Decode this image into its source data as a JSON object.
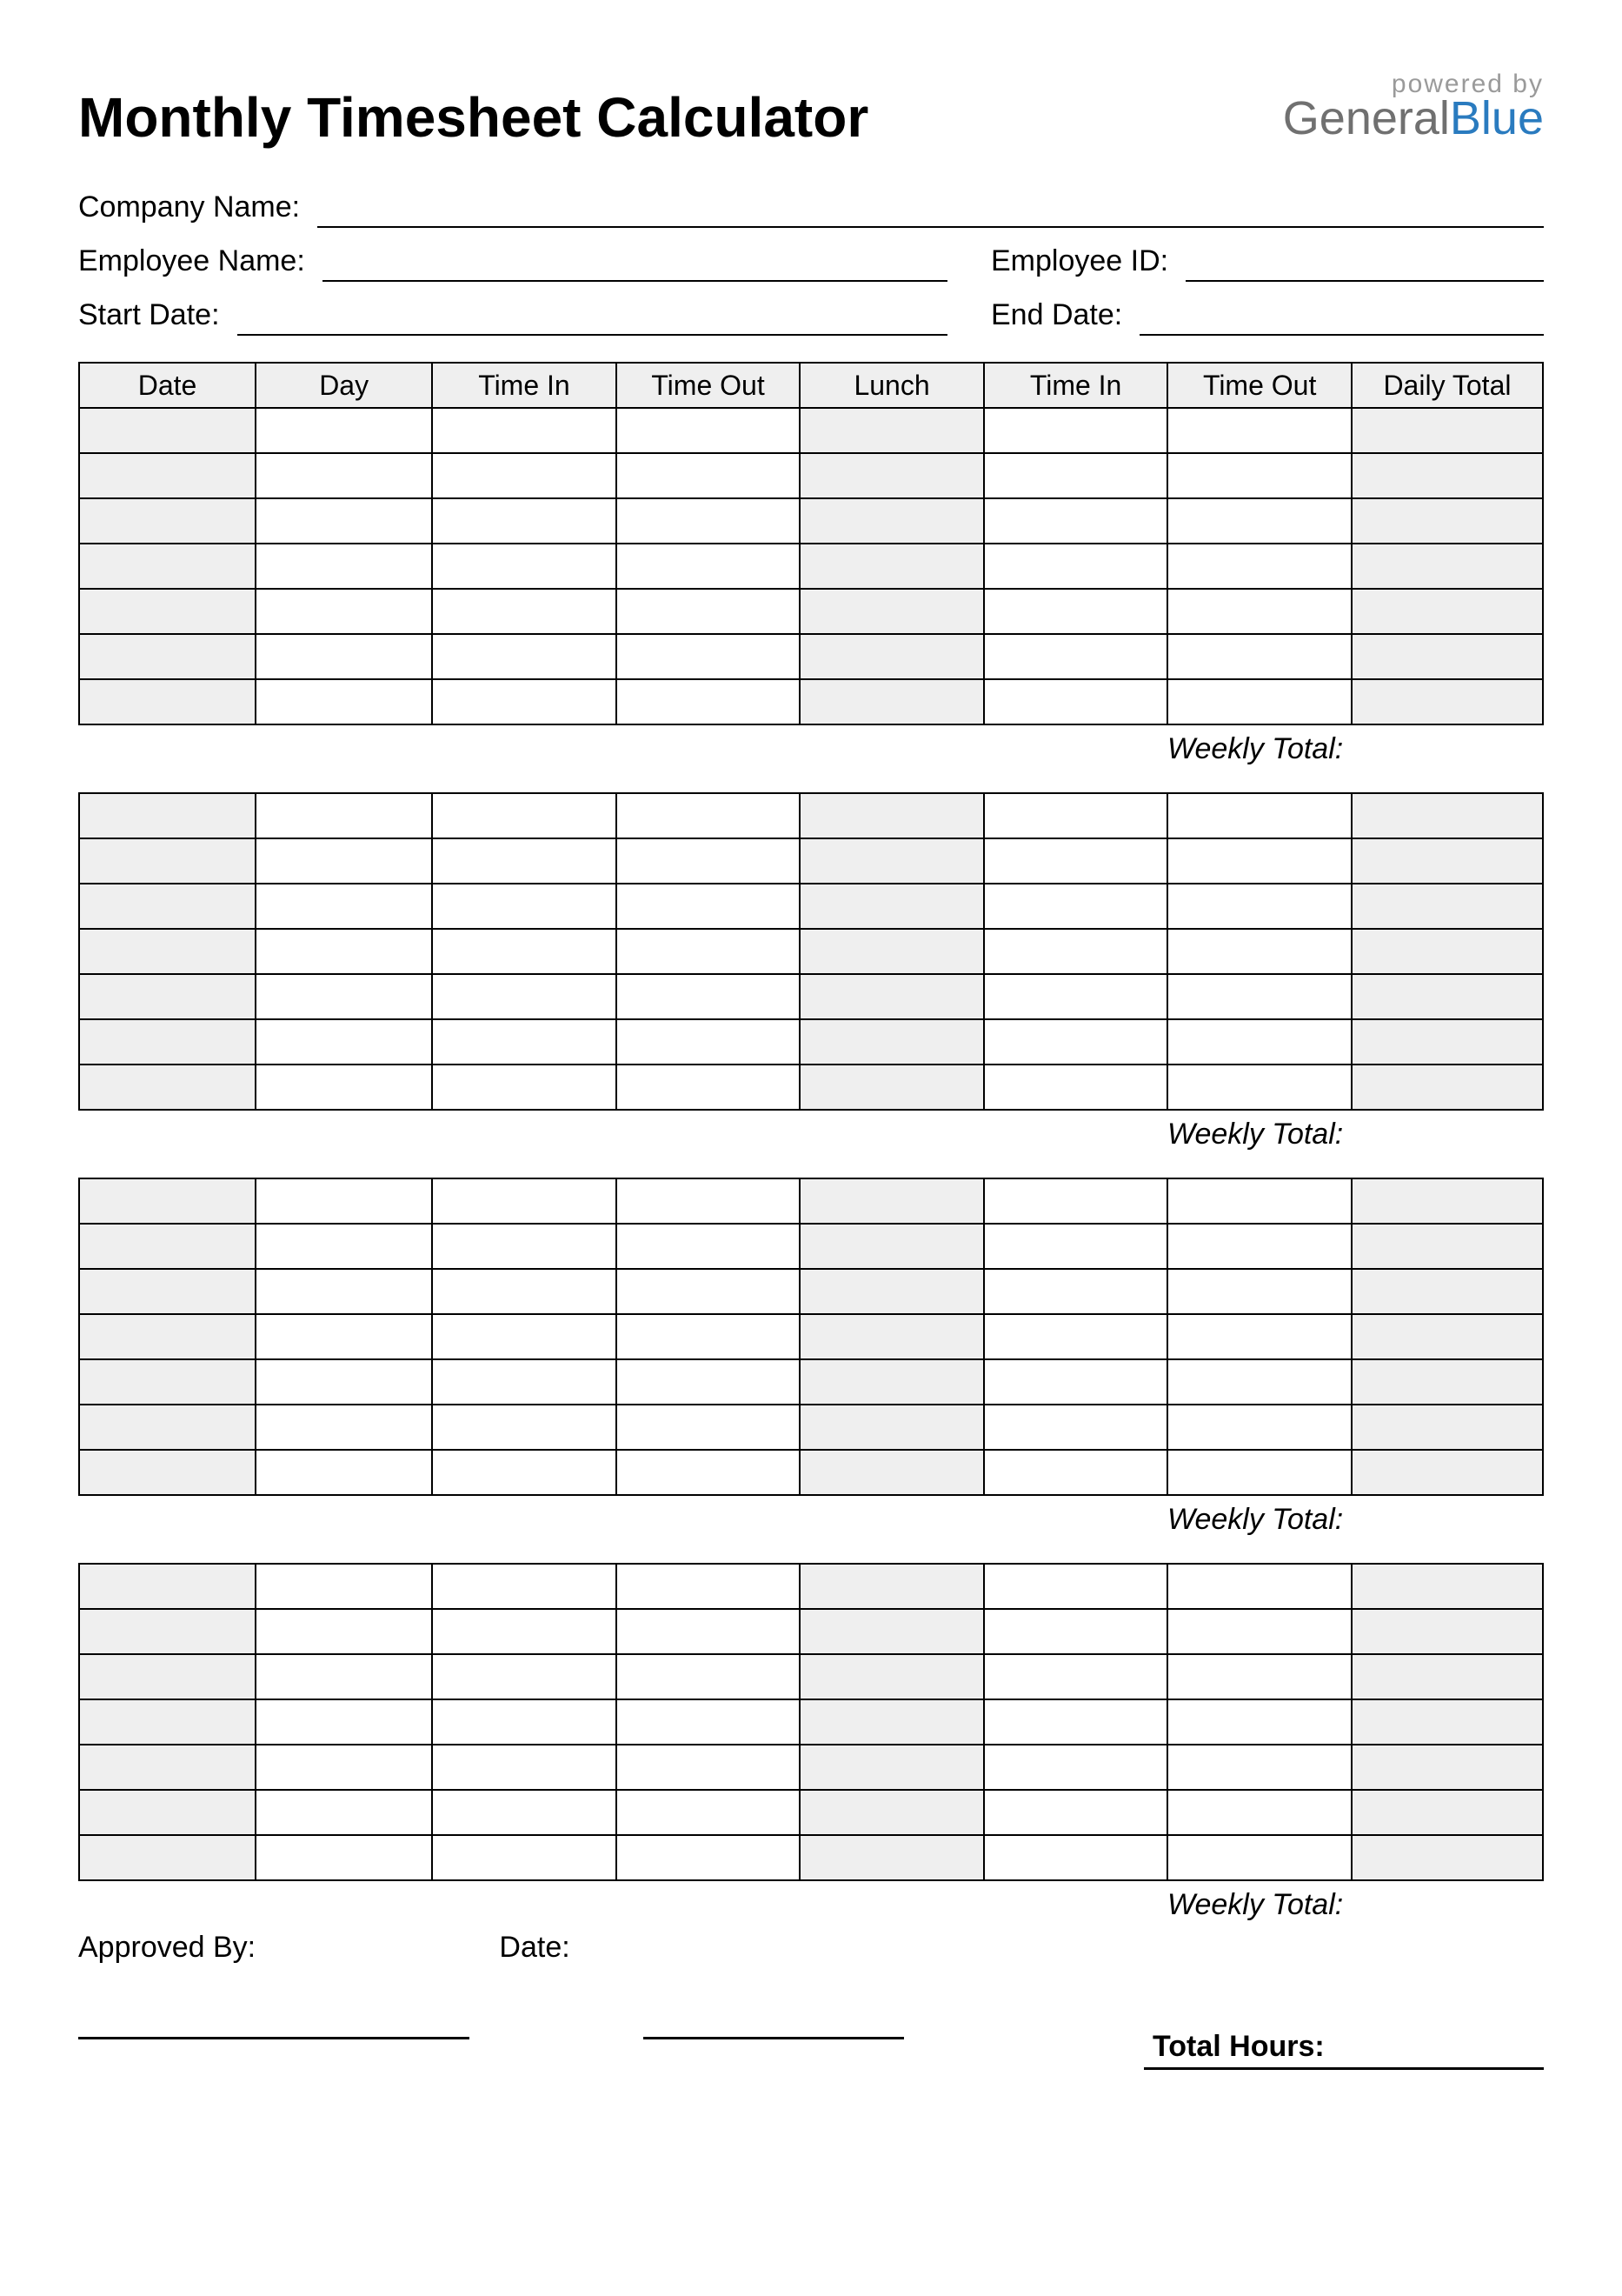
{
  "header": {
    "title": "Monthly Timesheet Calculator",
    "powered_by": "powered by",
    "logo_part1": "General",
    "logo_part2": "Blue"
  },
  "meta": {
    "company_name_label": "Company Name:",
    "employee_name_label": "Employee Name:",
    "employee_id_label": "Employee ID:",
    "start_date_label": "Start Date:",
    "end_date_label": "End Date:"
  },
  "columns": {
    "date": "Date",
    "day": "Day",
    "time_in_1": "Time In",
    "time_out_1": "Time Out",
    "lunch": "Lunch",
    "time_in_2": "Time In",
    "time_out_2": "Time Out",
    "daily_total": "Daily Total"
  },
  "weekly_total_label": "Weekly Total:",
  "footer": {
    "approved_by_label": "Approved By:",
    "date_label": "Date:",
    "total_hours_label": "Total Hours:"
  },
  "weeks": 4,
  "rows_per_week": 7
}
